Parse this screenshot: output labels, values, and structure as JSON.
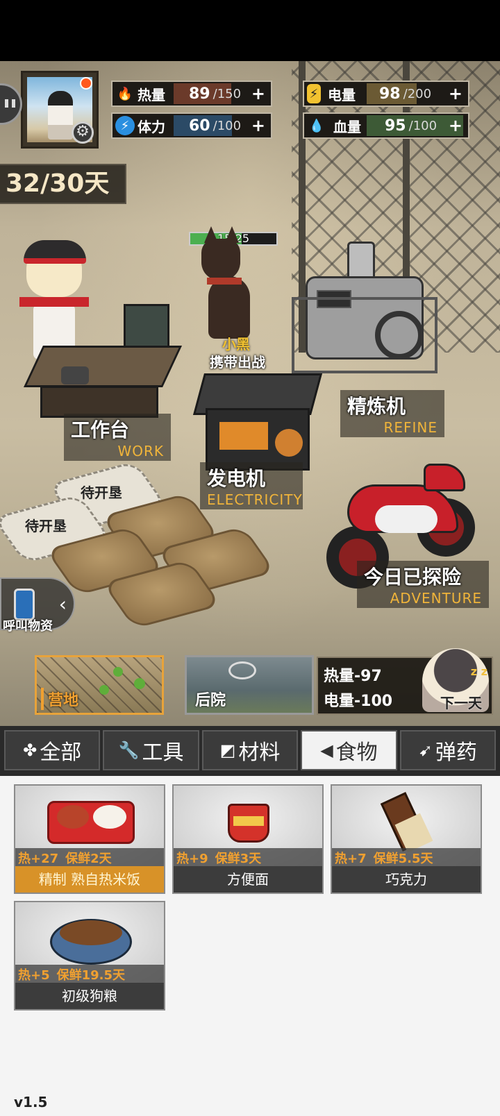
{
  "stats": {
    "heat": {
      "label": "热量",
      "value": "89",
      "max": "/150",
      "fill": 0.593,
      "color": "#6b3a2a",
      "icon_color": "#e8452c",
      "icon": "flame-icon"
    },
    "stamina": {
      "label": "体力",
      "value": "60",
      "max": "/100",
      "fill": 0.6,
      "color": "#2b4a66",
      "icon_color": "#2a8fe0",
      "icon": "lightning-icon"
    },
    "power": {
      "label": "电量",
      "value": "98",
      "max": "/200",
      "fill": 0.49,
      "color": "#6b5a34",
      "icon_color": "#f2c230",
      "icon": "battery-icon"
    },
    "health": {
      "label": "血量",
      "value": "95",
      "max": "/100",
      "fill": 0.95,
      "color": "#3d5a36",
      "icon_color": "#43b04a",
      "icon": "drop-plus-icon"
    },
    "plus": "+"
  },
  "days": "32/30天",
  "dog": {
    "hp": "15/25",
    "hp_fill": 0.6,
    "name": "小黑",
    "action": "携带出战"
  },
  "places": {
    "work": {
      "cn": "工作台",
      "en": "WORK"
    },
    "refine": {
      "cn": "精炼机",
      "en": "REFINE"
    },
    "electricity": {
      "cn": "发电机",
      "en": "ELECTRICITY"
    },
    "adventure": {
      "cn": "今日已探险",
      "en": "ADVENTURE"
    }
  },
  "plots": {
    "locked_label": "待开垦"
  },
  "call_supplies": "呼叫物资",
  "locations": [
    {
      "label": "营地"
    },
    {
      "label": "后院"
    }
  ],
  "next_day": {
    "heat_cost": "热量-97",
    "power_cost": "电量-100",
    "label": "下一天",
    "zzz": "z z"
  },
  "tabs": [
    {
      "label": "全部",
      "icon": "clover-icon"
    },
    {
      "label": "工具",
      "icon": "wrench-icon"
    },
    {
      "label": "材料",
      "icon": "material-icon"
    },
    {
      "label": "食物",
      "icon": "food-icon"
    },
    {
      "label": "弹药",
      "icon": "bullet-icon"
    }
  ],
  "items": [
    {
      "name": "精制 熟自热米饭",
      "heat": "热+27",
      "fresh": "保鲜2天",
      "gold": true
    },
    {
      "name": "方便面",
      "heat": "热+9",
      "fresh": "保鲜3天",
      "gold": false
    },
    {
      "name": "巧克力",
      "heat": "热+7",
      "fresh": "保鲜5.5天",
      "gold": false
    },
    {
      "name": "初级狗粮",
      "heat": "热+5",
      "fresh": "保鲜19.5天",
      "gold": false
    }
  ],
  "version": "v1.5"
}
